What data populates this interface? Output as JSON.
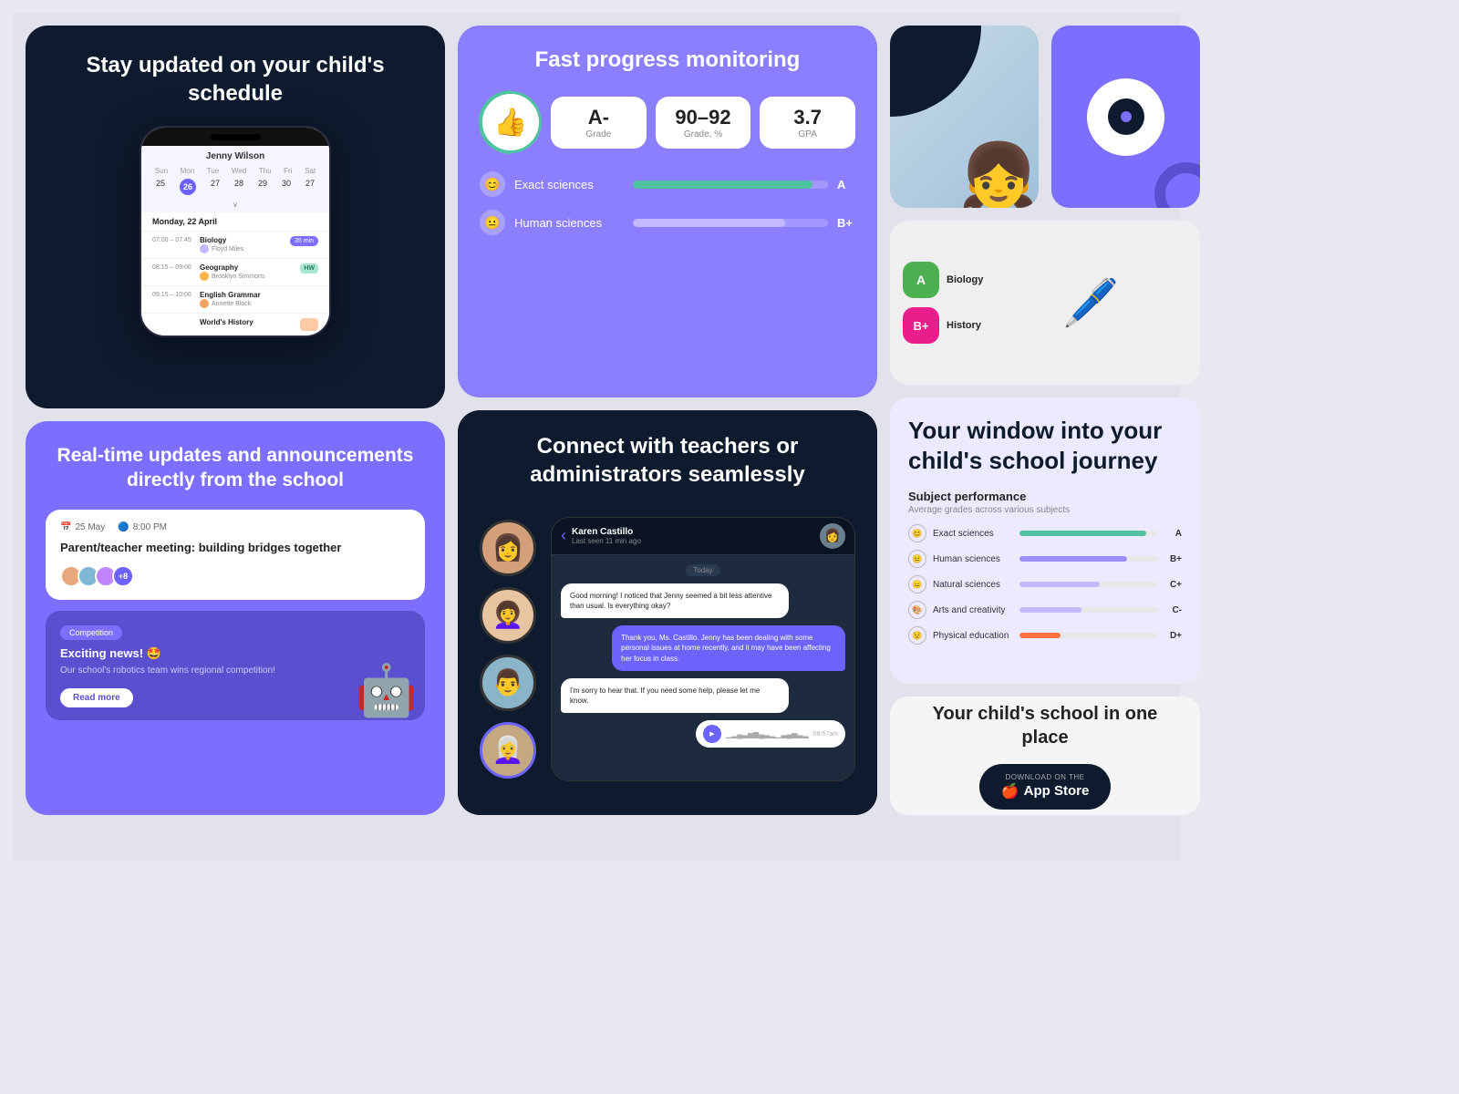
{
  "schedule": {
    "title": "Stay updated on your child's schedule",
    "user": "Jenny Wilson",
    "days": [
      "Sun",
      "Mon",
      "Tue",
      "Wed",
      "Thu",
      "Fri",
      "Sat"
    ],
    "dates": [
      "25",
      "26",
      "27",
      "28",
      "29",
      "30",
      "27"
    ],
    "activeDay": "26",
    "dateHeader": "Monday, 22 April",
    "classes": [
      {
        "time": "07:00 – 07:45",
        "name": "Biology",
        "teacher": "Floyd Miles",
        "badge": "35 min",
        "badgeType": "timer"
      },
      {
        "time": "08:15 – 09:00",
        "name": "Geography",
        "teacher": "Brooklyn Simmons",
        "badge": "HW",
        "badgeType": "hw"
      },
      {
        "time": "09:15 – 10:00",
        "name": "English Grammar",
        "teacher": "Annette Black",
        "badge": "",
        "badgeType": "none"
      },
      {
        "time": "",
        "name": "World's History",
        "teacher": "",
        "badge": "",
        "badgeType": "partial"
      }
    ]
  },
  "progress": {
    "title": "Fast progress monitoring",
    "grade_label": "Grade",
    "grade_value": "A-",
    "range_label": "Grade, %",
    "range_value": "90–92",
    "gpa_label": "GPA",
    "gpa_value": "3.7",
    "subjects": [
      {
        "name": "Exact sciences",
        "grade": "A",
        "fill": 92,
        "type": "green"
      },
      {
        "name": "Human sciences",
        "grade": "B+",
        "fill": 78,
        "type": "purple"
      }
    ]
  },
  "updates": {
    "title": "Real-time updates and announcements directly from the school",
    "announcement": {
      "date": "25 May",
      "time": "8:00 PM",
      "title": "Parent/teacher meeting: building bridges together",
      "attendees": "+8"
    },
    "news": {
      "tag": "Competition",
      "title": "Exciting news! 🤩",
      "description": "Our school's robotics team wins regional competition!",
      "button": "Read more"
    }
  },
  "connect": {
    "title": "Connect with teachers or administrators seamlessly",
    "chat": {
      "name": "Karen Castillo",
      "status": "Last seen 11 min ago",
      "teacher_badge": "Today",
      "messages": [
        {
          "text": "Good morning! I noticed that Jenny seemed a bit less attentive than usual. Is everything okay?",
          "type": "received"
        },
        {
          "text": "Thank you, Ms. Castillo. Jenny has been dealing with some personal issues at home recently, and it may have been affecting her focus in class.",
          "type": "sent"
        },
        {
          "text": "I'm sorry to hear that. If you need some help, please let me know.",
          "type": "received"
        }
      ],
      "voice_duration": "08:57am"
    }
  },
  "oneplace": {
    "title": "Your child's school in one place",
    "button_label": "App Store",
    "button_sublabel": "DOWNLOAD ON THE"
  },
  "window": {
    "title": "Your window into your child's school journey"
  },
  "subject_performance": {
    "title": "Subject performance",
    "subtitle": "Average grades across various subjects",
    "subjects": [
      {
        "name": "Exact sciences",
        "grade": "A",
        "fill": 92,
        "type": "green"
      },
      {
        "name": "Human sciences",
        "grade": "B+",
        "fill": 78,
        "type": "purple"
      },
      {
        "name": "Natural sciences",
        "grade": "C+",
        "fill": 58,
        "type": "lightpurple"
      },
      {
        "name": "Arts and creativity",
        "grade": "C-",
        "fill": 45,
        "type": "lightpurple"
      },
      {
        "name": "Physical education",
        "grade": "D+",
        "fill": 30,
        "type": "orange"
      }
    ]
  },
  "grades_preview": {
    "items": [
      {
        "label": "Biology",
        "grade": "A",
        "color": "green"
      },
      {
        "label": "History",
        "grade": "B+",
        "color": "pink"
      }
    ]
  },
  "icons": {
    "thumbs_up": "👍",
    "calendar": "📅",
    "clock": "🕗",
    "robot": "🤖",
    "apple": "",
    "back_arrow": "‹",
    "play": "▶",
    "smiley": "😊",
    "neutral": "😐",
    "sad": "😟",
    "palette": "🎨",
    "running": "🏃",
    "eye": "👁"
  }
}
